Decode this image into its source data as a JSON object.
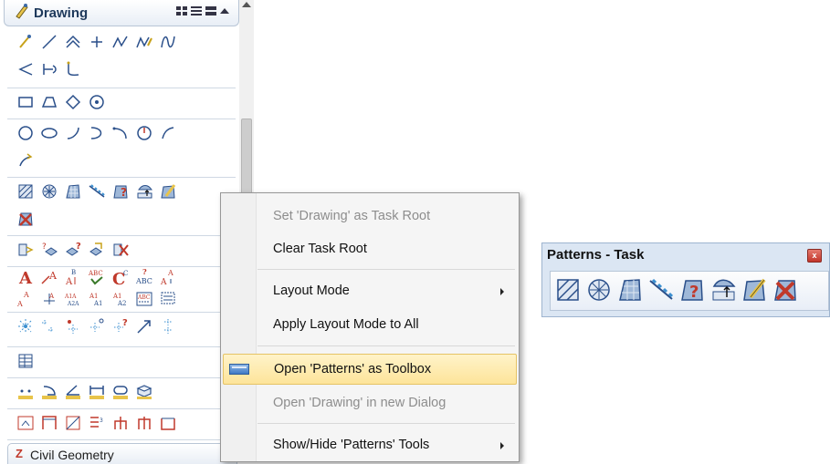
{
  "panel": {
    "title": "Drawing",
    "bottom_tab": "Civil Geometry"
  },
  "context_menu": {
    "items": [
      {
        "label": "Set 'Drawing' as Task Root",
        "disabled": true
      },
      {
        "label": "Clear Task Root",
        "disabled": false
      },
      {
        "label": "Layout Mode",
        "submenu": true
      },
      {
        "label": "Apply Layout Mode to All",
        "disabled": false
      },
      {
        "label": "Open 'Patterns' as Toolbox",
        "highlighted": true
      },
      {
        "label": "Open 'Drawing' in new Dialog",
        "disabled": true
      },
      {
        "label": "Show/Hide 'Patterns' Tools",
        "submenu": true
      }
    ]
  },
  "patterns_window": {
    "title": "Patterns - Task",
    "close_label": "x"
  },
  "colors": {
    "highlight": "#fde49a",
    "panel_border": "#b9c6d6",
    "toolbar_bg": "#dbe6f3"
  }
}
